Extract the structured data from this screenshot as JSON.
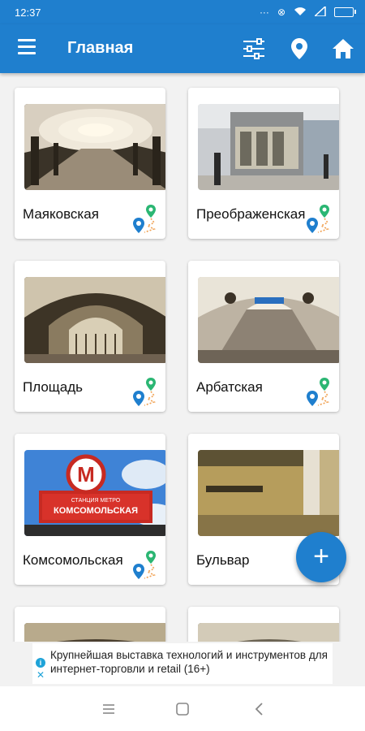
{
  "status": {
    "time": "12:37"
  },
  "appbar": {
    "title": "Главная"
  },
  "stations": [
    {
      "name": "Маяковская"
    },
    {
      "name": "Преображенская"
    },
    {
      "name": "Площадь"
    },
    {
      "name": "Арбатская"
    },
    {
      "name": "Комсомольская"
    },
    {
      "name": "Бульвар"
    }
  ],
  "sign": {
    "letter": "М",
    "line1": "СТАНЦИЯ МЕТРО",
    "line2": "КОМСОМОЛЬСКАЯ"
  },
  "fab": {
    "label": "+"
  },
  "ad": {
    "text": "Крупнейшая выставка технологий и инструментов для интернет-торговли и retail (16+)",
    "info": "i",
    "close": "✕"
  },
  "colors": {
    "primary": "#1f7fce",
    "marker_blue": "#1f7fce",
    "marker_green": "#2bb673",
    "route_orange": "#f0a254"
  }
}
